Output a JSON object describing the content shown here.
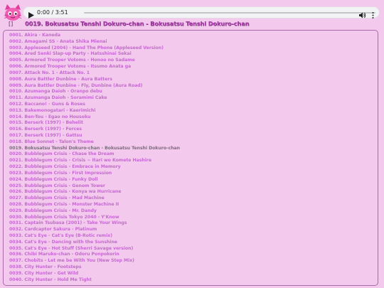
{
  "player": {
    "time": "0:00 / 3:51",
    "progress_fraction": 0.0
  },
  "now_playing": {
    "bracket": "[]",
    "title": "0019. Bokusatsu Tenshi Dokuro-chan - Bokusatsu Tenshi Dokuro-chan"
  },
  "colors": {
    "background": "#f4c9ee",
    "track_text": "#c56ad1",
    "active_track_text": "#7b6e7d",
    "title_text": "#a83ea8"
  },
  "icons": {
    "logo": "pink-anime-cat-logo",
    "play": "play-icon",
    "volume": "volume-icon",
    "more": "more-options-icon"
  },
  "active_index": 18,
  "tracks": [
    "0001. Akira - Kaneda",
    "0002. Amagami SS - Anata Shika Mienai",
    "0003. Appleseed (2004) - Hand The Phone (Appleseed Version)",
    "0004. Ared Senki Slap-up Party - Hatsshinai Sekai",
    "0005. Armored Trooper Votoms - Honoo no Sadame",
    "0006. Armored Trooper Votoms - Itsumo Anata ga",
    "0007. Attack No. 1 - Attack No. 1",
    "0008. Aura Battler Dunbine - Aura Batters",
    "0009. Aura Battler Dunbine - Fly, Dunbine (Aura Road)",
    "0010. Azumanga Daioh - Oranpo debu",
    "0011. Azumanga Daioh - Soramimi Cake",
    "0012. Baccano! - Guns & Roses",
    "0013. Bakemonogatari - Kaerimichi",
    "0014. Ben-Tou - Egao no Housoku",
    "0015. Berserk (1997) - Behelit",
    "0016. Berserk (1997) - Forces",
    "0017. Berserk (1997) - Gattsu",
    "0018. Blue Sonnet - Talon's Theme",
    "0019. Bokusatsu Tenshi Dokuro-chan - Bokusatsu Tenshi Dokuro-chan",
    "0020. Bubblegum Crisis - Chase the Dream",
    "0021. Bubblegum Crisis - Crisis ~ Itari wo Komete Hashire",
    "0022. Bubblegum Crisis - Embrace in Memory",
    "0023. Bubblegum Crisis - First Impression",
    "0024. Bubblegum Crisis - Funky Doll",
    "0025. Bubblegum Crisis - Genom Tower",
    "0026. Bubblegum Crisis - Konya wa Hurricane",
    "0027. Bubblegum Crisis - Mad Machine",
    "0028. Bubblegum Crisis - Monster Machine II",
    "0029. Bubblegum Crisis - Mr. Dandy",
    "0030. Bubblegum Crisis Tokyo 2040 - Y'Know",
    "0031. Captain Tsubasa (2001) - Take Your Wings",
    "0032. Cardcaptor Sakura - Platinum",
    "0033. Cat's Eye - Cat's Eye (B-Rotic remix)",
    "0034. Cat's Eye - Dancing with the Sunshine",
    "0035. Cat's Eye - Hot Stuff (Sherri Savage version)",
    "0036. Chibi Maruko-chan - Odoru Ponpokorin",
    "0037. Chobits - Let me be With You (New Step Mix)",
    "0038. City Hunter - Footsteps",
    "0039. City Hunter - Get Wild",
    "0040. City Hunter - Hold Me Tight"
  ]
}
